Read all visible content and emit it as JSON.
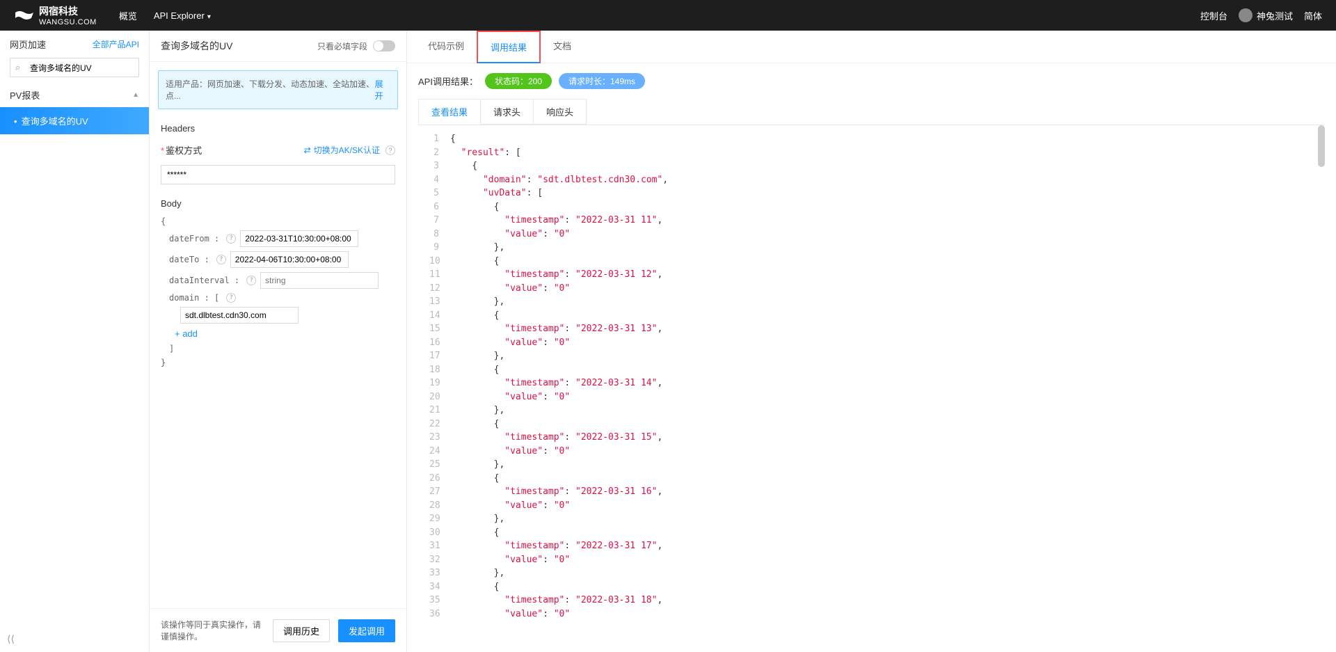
{
  "header": {
    "brand_cn": "网宿科技",
    "brand_en": "WANGSU.COM",
    "nav_overview": "概览",
    "nav_api_explorer": "API Explorer",
    "console": "控制台",
    "user": "神兔测试",
    "lang": "简体"
  },
  "sidebar": {
    "title": "网页加速",
    "all_products": "全部产品API",
    "search_value": "查询多域名的UV",
    "section": "PV报表",
    "active_item": "查询多域名的UV"
  },
  "middle": {
    "title": "查询多域名的UV",
    "toggle_label": "只看必填字段",
    "info_text": "适用产品：网页加速、下载分发、动态加速、全站加速、点...",
    "expand": "展开",
    "headers_label": "Headers",
    "auth_label": "鉴权方式",
    "auth_switch": "切换为AK/SK认证",
    "auth_value": "******",
    "body_label": "Body",
    "dateFrom_label": "dateFrom :",
    "dateFrom_value": "2022-03-31T10:30:00+08:00",
    "dateTo_label": "dateTo :",
    "dateTo_value": "2022-04-06T10:30:00+08:00",
    "dataInterval_label": "dataInterval :",
    "dataInterval_placeholder": "string",
    "domain_label": "domain :  [",
    "domain_value": "sdt.dlbtest.cdn30.com",
    "add_label": "+ add",
    "footer_text": "该操作等同于真实操作，请谨慎操作。",
    "btn_history": "调用历史",
    "btn_call": "发起调用"
  },
  "right": {
    "tabs": {
      "code": "代码示例",
      "result": "调用结果",
      "doc": "文档"
    },
    "api_result_label": "API调用结果：",
    "status_label": "状态码：200",
    "time_label": "请求时长：149ms",
    "sub_tabs": {
      "view": "查看结果",
      "req": "请求头",
      "res": "响应头"
    },
    "json_lines": [
      "{",
      "  \"result\": [",
      "    {",
      "      \"domain\": \"sdt.dlbtest.cdn30.com\",",
      "      \"uvData\": [",
      "        {",
      "          \"timestamp\": \"2022-03-31 11\",",
      "          \"value\": \"0\"",
      "        },",
      "        {",
      "          \"timestamp\": \"2022-03-31 12\",",
      "          \"value\": \"0\"",
      "        },",
      "        {",
      "          \"timestamp\": \"2022-03-31 13\",",
      "          \"value\": \"0\"",
      "        },",
      "        {",
      "          \"timestamp\": \"2022-03-31 14\",",
      "          \"value\": \"0\"",
      "        },",
      "        {",
      "          \"timestamp\": \"2022-03-31 15\",",
      "          \"value\": \"0\"",
      "        },",
      "        {",
      "          \"timestamp\": \"2022-03-31 16\",",
      "          \"value\": \"0\"",
      "        },",
      "        {",
      "          \"timestamp\": \"2022-03-31 17\",",
      "          \"value\": \"0\"",
      "        },",
      "        {",
      "          \"timestamp\": \"2022-03-31 18\",",
      "          \"value\": \"0\""
    ]
  }
}
